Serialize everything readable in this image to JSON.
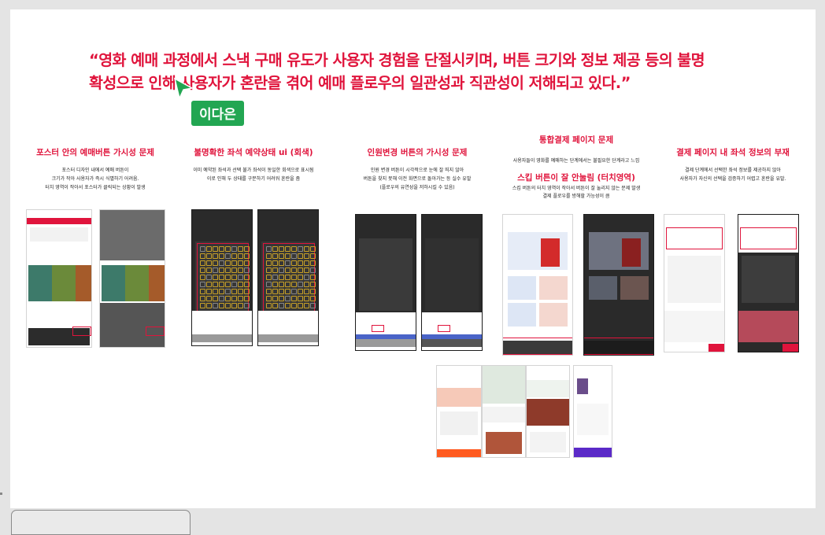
{
  "quote": {
    "line1": "“영화 예매 과정에서 스낵 구매 유도가 사용자 경험을 단절시키며, 버튼 크기와 정보 제공 등의 불명",
    "line2": "확성으로 인해 사용자가 혼란을 겪어 예매 플로우의 일관성과 직관성이 저해되고 있다.”"
  },
  "cursor_tag": "이다은",
  "sections": [
    {
      "title": "포스터 안의 예매버튼 가시성 문제",
      "desc": [
        "포스터 디자인 내에서 예매 버튼이",
        "크기가 작아 사용자가 즉시 식별하기 어려움.",
        "터치 영역이 작아서 포스터가 클릭되는 상황이 발생"
      ]
    },
    {
      "title": "불명확한 좌석 예약상태 ui (회색)",
      "desc": [
        "이미 예약된 좌석과 선택 불가 좌석이 동일한 회색으로 표시됨",
        "이로 인해 두 상태를 구분하기 어려워 혼란을 줌"
      ]
    },
    {
      "title": "인원변경 버튼의 가시성 문제",
      "desc": [
        "인원 변경 버튼이 시각적으로 눈에 잘 띄지 않아",
        "버튼을 찾지 못해 이전 화면으로 돌아가는 등 실수 유발",
        "(플로우의 유연성을 저하시킬 수 있음)"
      ]
    },
    {
      "title": "통합결제 페이지 문제",
      "desc": [
        "사용자들이 영화를 예매하는 단계에서는 불필요한 단계라고 느낌"
      ],
      "sub": "스킵 버튼이 잘 안눌림 (터치영역)",
      "sub_desc": [
        "스킵 버튼의 터치 영역이 작아서 버튼이 잘 눌리지 않는 문제 발생",
        "결제 플로우를 방해할 가능성이 큼"
      ]
    },
    {
      "title": "결제 페이지 내 좌석 정보의 부재",
      "desc": [
        "결제 단계에서 선택한 좌석 정보를 제공하지 않아",
        "사용자가 자신의 선택을 검증하기 어렵고 혼란을 유발."
      ]
    }
  ],
  "colors": {
    "accent": "#e0143c",
    "tag": "#22a652"
  }
}
